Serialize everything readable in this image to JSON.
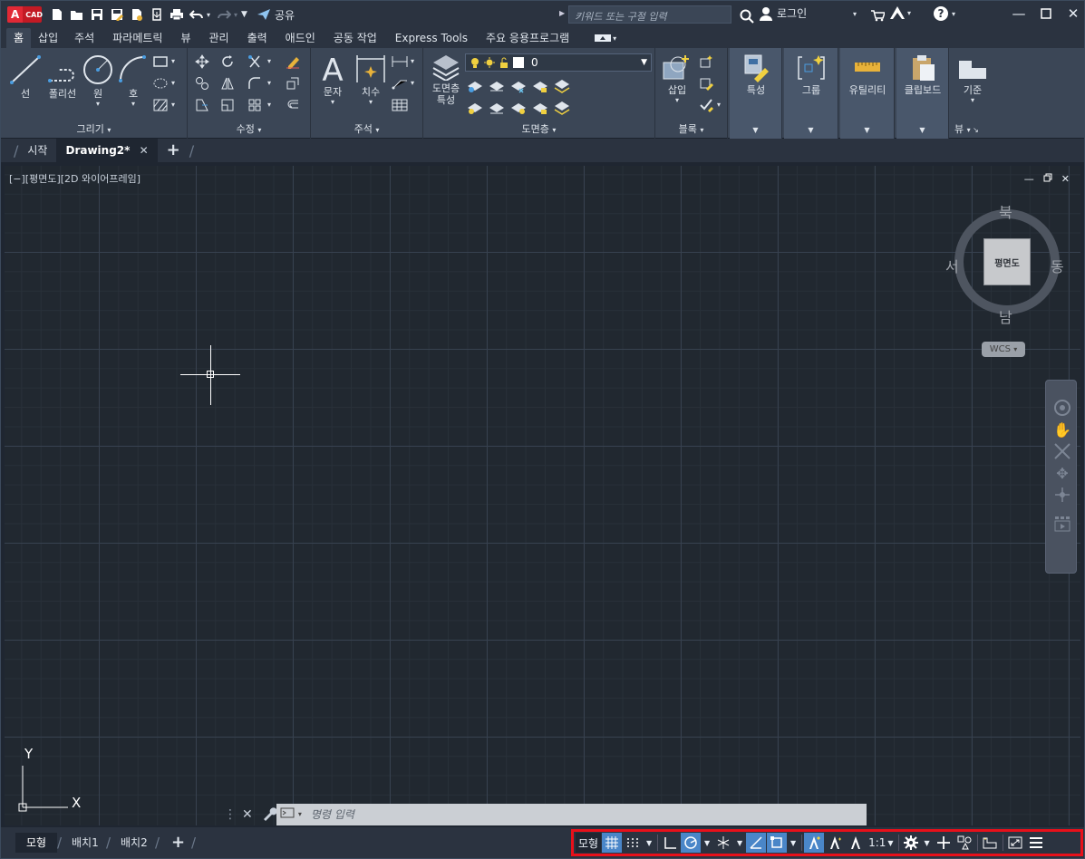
{
  "app": {
    "logo_letter": "A",
    "logo_text": "CAD"
  },
  "titlebar": {
    "share_label": "공유",
    "search_placeholder": "키워드 또는 구절 입력",
    "login_label": "로그인"
  },
  "ribbon_tabs": [
    "홈",
    "삽입",
    "주석",
    "파라메트릭",
    "뷰",
    "관리",
    "출력",
    "애드인",
    "공동 작업",
    "Express Tools",
    "주요 응용프로그램"
  ],
  "ribbon": {
    "draw": {
      "title": "그리기",
      "line": "선",
      "polyline": "폴리선",
      "circle": "원",
      "arc": "호"
    },
    "modify": {
      "title": "수정"
    },
    "annotation": {
      "title": "주석",
      "text": "문자",
      "dimension": "치수"
    },
    "layers": {
      "title": "도면층",
      "props_line1": "도면층",
      "props_line2": "특성",
      "current_layer": "0"
    },
    "block": {
      "title": "블록",
      "insert": "삽입"
    },
    "properties": {
      "label": "특성"
    },
    "groups": {
      "label": "그룹"
    },
    "utilities": {
      "label": "유틸리티"
    },
    "clipboard": {
      "label": "클립보드"
    },
    "view": {
      "base": "기준",
      "title": "뷰"
    }
  },
  "doc_tabs": {
    "start": "시작",
    "drawing": "Drawing2*"
  },
  "viewport": {
    "label": "[−][평면도][2D 와이어프레임]"
  },
  "viewcube": {
    "face": "평면도",
    "north": "북",
    "south": "남",
    "east": "동",
    "west": "서",
    "wcs": "WCS"
  },
  "ucs": {
    "x": "X",
    "y": "Y"
  },
  "command": {
    "placeholder": "명령 입력"
  },
  "layout_tabs": {
    "model": "모형",
    "layout1": "배치1",
    "layout2": "배치2"
  },
  "status": {
    "model": "모형",
    "scale": "1:1"
  },
  "colors": {
    "accent": "#4a86c8",
    "highlight_border": "#e8101a",
    "logo_red": "#c21a24"
  }
}
